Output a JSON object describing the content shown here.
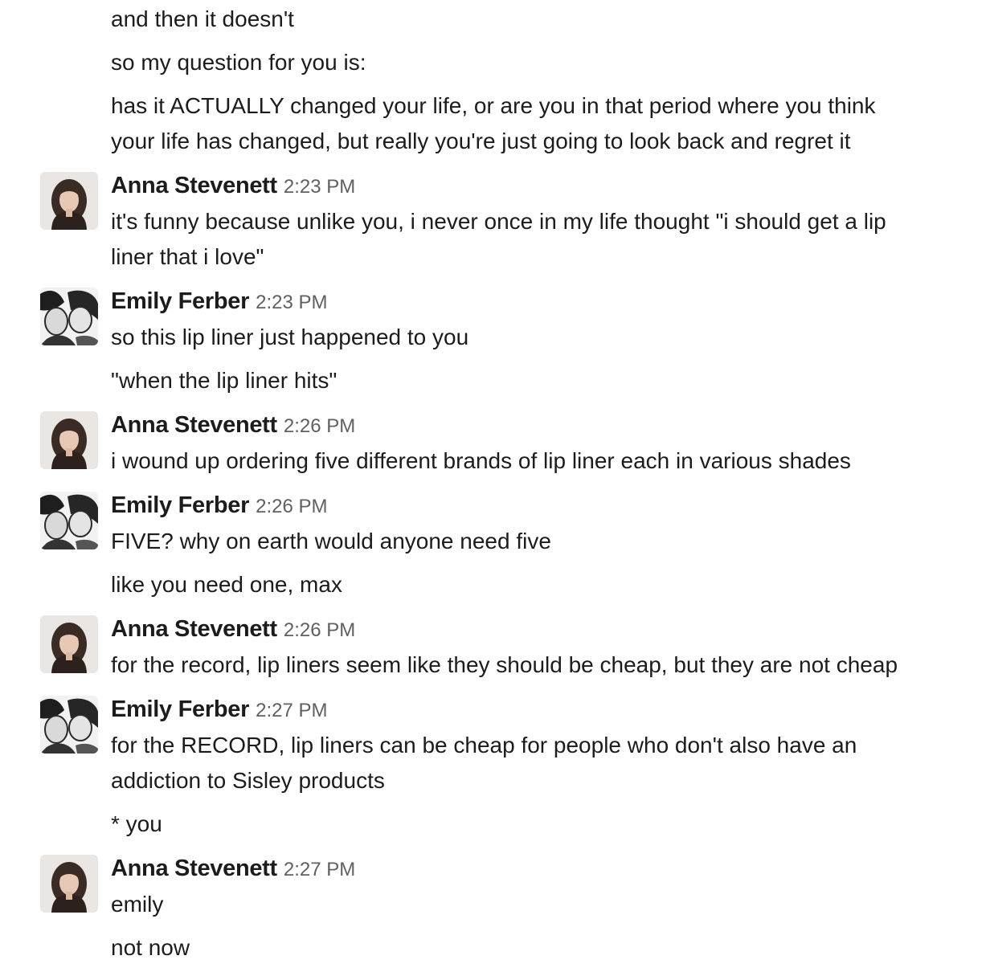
{
  "users": {
    "anna": {
      "name": "Anna Stevenett"
    },
    "emily": {
      "name": "Emily Ferber"
    }
  },
  "lead_messages": [
    "and then it doesn't",
    "so my question for you is:",
    "has it ACTUALLY changed your life, or are you in that period where you think",
    "your life has changed, but really you're just going to look back and regret it"
  ],
  "groups": [
    {
      "author": "Anna Stevenett",
      "avatar": "anna-avatar",
      "time": "2:23 PM",
      "lines": [
        "it's funny because unlike you, i never once in my life thought \"i should get a lip",
        "liner that i love\""
      ]
    },
    {
      "author": "Emily Ferber",
      "avatar": "emily-avatar",
      "time": "2:23 PM",
      "lines": [
        "so this lip liner just happened to you",
        "\"when the lip liner hits\""
      ]
    },
    {
      "author": "Anna Stevenett",
      "avatar": "anna-avatar",
      "time": "2:26 PM",
      "lines": [
        "i wound up ordering five different brands of lip liner each in various shades"
      ]
    },
    {
      "author": "Emily Ferber",
      "avatar": "emily-avatar",
      "time": "2:26 PM",
      "lines": [
        "FIVE? why on earth would anyone need five",
        "like you need one, max"
      ]
    },
    {
      "author": "Anna Stevenett",
      "avatar": "anna-avatar",
      "time": "2:26 PM",
      "lines": [
        "for the record, lip liners seem like they should be cheap, but they are not cheap"
      ]
    },
    {
      "author": "Emily Ferber",
      "avatar": "emily-avatar",
      "time": "2:27 PM",
      "lines": [
        "for the RECORD, lip liners can be cheap for people who don't also have an",
        "addiction to Sisley products",
        "* you"
      ]
    },
    {
      "author": "Anna Stevenett",
      "avatar": "anna-avatar",
      "time": "2:27 PM",
      "lines": [
        "emily",
        "not now"
      ]
    }
  ]
}
